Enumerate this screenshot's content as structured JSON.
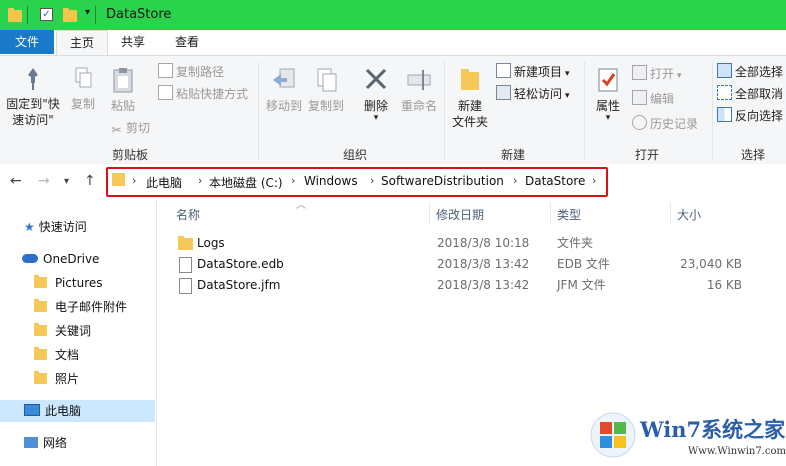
{
  "window": {
    "title": "DataStore"
  },
  "tabs": [
    {
      "label": "文件"
    },
    {
      "label": "主页"
    },
    {
      "label": "共享"
    },
    {
      "label": "查看"
    }
  ],
  "ribbon": {
    "clipboard": {
      "label": "剪贴板",
      "pin": "固定到\"快\n速访问\"",
      "copy": "复制",
      "paste": "粘贴",
      "copy_path": "复制路径",
      "paste_shortcut": "粘贴快捷方式",
      "cut": "剪切"
    },
    "organize": {
      "label": "组织",
      "move_to": "移动到",
      "copy_to": "复制到",
      "delete": "删除",
      "rename": "重命名"
    },
    "new": {
      "label": "新建",
      "new_folder": "新建\n文件夹",
      "new_item": "新建项目",
      "easy_access": "轻松访问"
    },
    "open": {
      "label": "打开",
      "properties": "属性",
      "open": "打开",
      "edit": "编辑",
      "history": "历史记录"
    },
    "select": {
      "label": "选择",
      "select_all": "全部选择",
      "select_none": "全部取消",
      "invert": "反向选择"
    }
  },
  "address": {
    "crumbs": [
      "此电脑",
      "本地磁盘 (C:)",
      "Windows",
      "SoftwareDistribution",
      "DataStore"
    ]
  },
  "nav_pane": {
    "items": [
      {
        "label": "快速访问",
        "icon": "star-icon"
      },
      {
        "label": "OneDrive",
        "icon": "cloud-icon"
      },
      {
        "label": "Pictures",
        "icon": "folder-icon"
      },
      {
        "label": "电子邮件附件",
        "icon": "folder-icon"
      },
      {
        "label": "关键词",
        "icon": "folder-icon"
      },
      {
        "label": "文档",
        "icon": "folder-icon"
      },
      {
        "label": "照片",
        "icon": "folder-icon"
      },
      {
        "label": "此电脑",
        "icon": "computer-icon"
      },
      {
        "label": "网络",
        "icon": "network-icon"
      }
    ]
  },
  "file_list": {
    "columns": [
      "名称",
      "修改日期",
      "类型",
      "大小"
    ],
    "rows": [
      {
        "name": "Logs",
        "date": "2018/3/8 10:18",
        "type": "文件夹",
        "size": ""
      },
      {
        "name": "DataStore.edb",
        "date": "2018/3/8 13:42",
        "type": "EDB 文件",
        "size": "23,040 KB"
      },
      {
        "name": "DataStore.jfm",
        "date": "2018/3/8 13:42",
        "type": "JFM 文件",
        "size": "16 KB"
      }
    ]
  },
  "watermark": {
    "brand": "Win7系统之家",
    "url": "Www.Winwin7.com"
  },
  "colors": {
    "titlebar": "#2bd34c",
    "file_tab": "#1979ca",
    "highlight_border": "#d9111b",
    "selected_nav": "#cce8ff"
  }
}
